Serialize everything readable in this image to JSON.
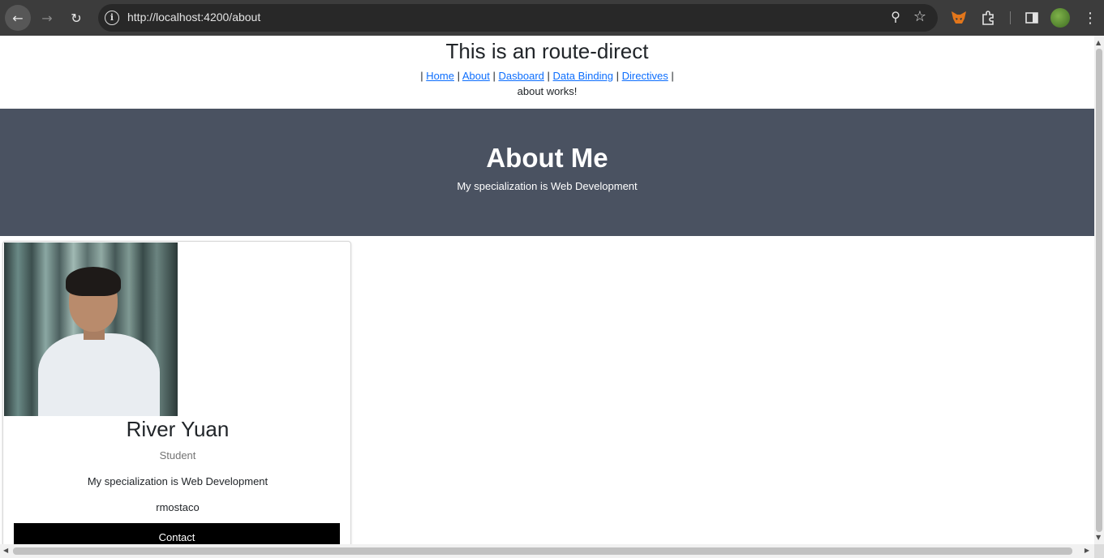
{
  "browser": {
    "url": "http://localhost:4200/about",
    "icons": [
      "back-arrow-icon",
      "forward-arrow-icon",
      "reload-icon",
      "site-info-icon",
      "zoom-icon",
      "bookmark-star-icon",
      "metamask-fox-icon",
      "extensions-puzzle-icon",
      "side-panel-icon",
      "profile-avatar-icon",
      "kebab-menu-icon"
    ]
  },
  "header": {
    "title": "This is an route-direct",
    "nav": {
      "separator": "|",
      "links": [
        "Home",
        "About",
        "Dasboard",
        "Data Binding",
        "Directives"
      ]
    },
    "status": "about works!"
  },
  "hero": {
    "heading": "About Me",
    "subheading": "My specialization is Web Development",
    "background": "#4a5261"
  },
  "profile_card": {
    "name": "River Yuan",
    "role": "Student",
    "specialization": "My specialization is Web Development",
    "handle": "rmostaco",
    "contact_label": "Contact"
  }
}
